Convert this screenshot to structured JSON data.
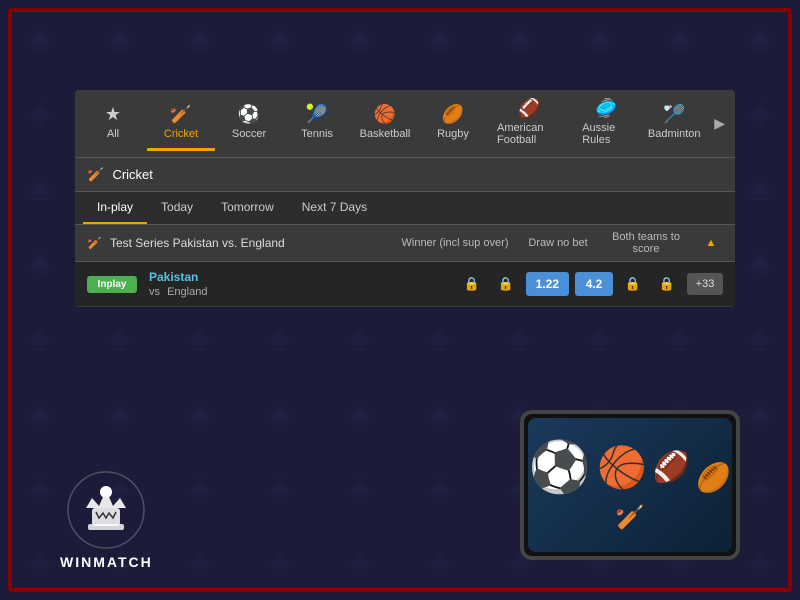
{
  "background": {
    "suit": "♠",
    "border_color": "#8b0000"
  },
  "sports_nav": {
    "tabs": [
      {
        "id": "all",
        "label": "All",
        "icon": "★",
        "active": false
      },
      {
        "id": "cricket",
        "label": "Cricket",
        "icon": "🏏",
        "active": true
      },
      {
        "id": "soccer",
        "label": "Soccer",
        "icon": "⚽",
        "active": false
      },
      {
        "id": "tennis",
        "label": "Tennis",
        "icon": "🎾",
        "active": false
      },
      {
        "id": "basketball",
        "label": "Basketball",
        "icon": "🏀",
        "active": false
      },
      {
        "id": "rugby",
        "label": "Rugby",
        "icon": "🏉",
        "active": false
      },
      {
        "id": "american_football",
        "label": "American Football",
        "icon": "🏈",
        "active": false
      },
      {
        "id": "aussie_rules",
        "label": "Aussie Rules",
        "icon": "🥏",
        "active": false
      },
      {
        "id": "badminton",
        "label": "Badminton",
        "icon": "🏸",
        "active": false
      }
    ],
    "more_arrow": "▶"
  },
  "section": {
    "icon": "🏏",
    "title": "Cricket"
  },
  "time_tabs": {
    "tabs": [
      {
        "label": "In-play",
        "active": true
      },
      {
        "label": "Today",
        "active": false
      },
      {
        "label": "Tomorrow",
        "active": false
      },
      {
        "label": "Next 7 Days",
        "active": false
      }
    ]
  },
  "match_group": {
    "icon": "🏏",
    "title": "Test Series Pakistan vs. England",
    "col_winner": "Winner (incl sup over)",
    "col_draw": "Draw no bet",
    "col_both": "Both teams to score"
  },
  "match": {
    "status": "Inplay",
    "team_home": "Pakistan",
    "team_vs": "vs",
    "team_away": "England",
    "odds": {
      "home_locked": true,
      "draw_locked": true,
      "away_odds_1": "1.22",
      "away_odds_2": "4.2",
      "locked_a": true,
      "locked_b": true,
      "more": "+33"
    }
  },
  "logo": {
    "text": "WINMATCH"
  }
}
